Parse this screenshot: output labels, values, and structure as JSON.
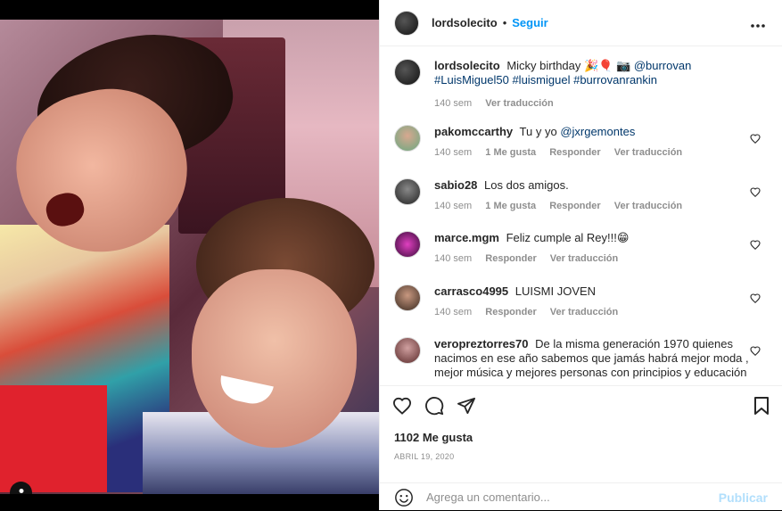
{
  "post": {
    "author": "lordsolecito",
    "follow_label": "Seguir",
    "dot": "•",
    "more_label": "•••"
  },
  "caption": {
    "user": "lordsolecito",
    "text": "Micky birthday 🎉🎈 📷",
    "mentions": "@burrovan #LuisMiguel50 #luismiguel #burrovanrankin",
    "time": "140 sem",
    "translate": "Ver traducción"
  },
  "comments": [
    {
      "user": "pakomccarthy",
      "text": "Tu y yo ",
      "mention": "@jxrgemontes",
      "time": "140 sem",
      "likes": "1 Me gusta",
      "reply": "Responder",
      "translate": "Ver traducción"
    },
    {
      "user": "sabio28",
      "text": "Los dos amigos.",
      "mention": "",
      "time": "140 sem",
      "likes": "1 Me gusta",
      "reply": "Responder",
      "translate": "Ver traducción"
    },
    {
      "user": "marce.mgm",
      "text": "Feliz cumple al Rey!!!😁",
      "mention": "",
      "time": "140 sem",
      "likes": "",
      "reply": "Responder",
      "translate": "Ver traducción"
    },
    {
      "user": "carrasco4995",
      "text": "LUISMI JOVEN",
      "mention": "",
      "time": "140 sem",
      "likes": "",
      "reply": "Responder",
      "translate": "Ver traducción"
    },
    {
      "user": "veropreztorres70",
      "text": "De la misma generación 1970 quienes nacimos en ese año sabemos que jamás habrá mejor moda , mejor música y mejores personas con principios y educación",
      "mention": "",
      "time": "",
      "likes": "",
      "reply": "",
      "translate": ""
    }
  ],
  "actions": {
    "likes": "1102 Me gusta",
    "date": "ABRIL 19, 2020"
  },
  "add_comment": {
    "placeholder": "Agrega un comentario...",
    "publish": "Publicar"
  },
  "colors": {
    "accent": "#0095f6",
    "link": "#00376b",
    "muted": "#8e8e8e",
    "publish_disabled": "#b2dffc"
  }
}
